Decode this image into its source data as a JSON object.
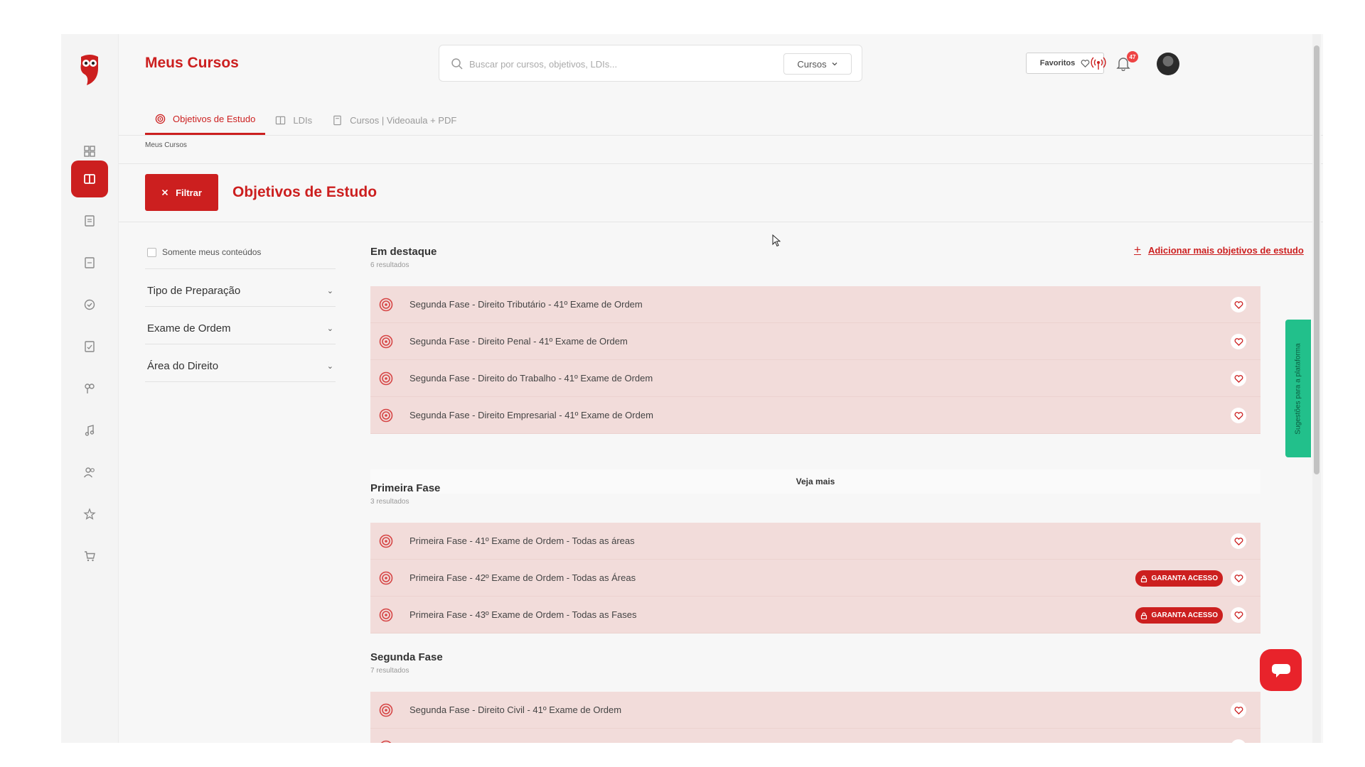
{
  "header": {
    "title": "Meus Cursos",
    "search_placeholder": "Buscar por cursos, objetivos, LDIs...",
    "search_scope": "Cursos",
    "favorites_label": "Favoritos",
    "notification_count": "47"
  },
  "tabs": [
    {
      "label": "Objetivos de Estudo",
      "icon": "target-icon",
      "active": true
    },
    {
      "label": "LDIs",
      "icon": "book-open-icon",
      "active": false
    },
    {
      "label": "Cursos | Videoaula + PDF",
      "icon": "book-icon",
      "active": false
    }
  ],
  "breadcrumb": "Meus Cursos",
  "filter_button": "Filtrar",
  "section_title": "Objetivos de Estudo",
  "filters": {
    "only_mine": "Somente meus conteúdos",
    "items": [
      "Tipo de Preparação",
      "Exame de Ordem",
      "Área do Direito"
    ]
  },
  "add_link": "Adicionar mais objetivos de estudo",
  "groups": [
    {
      "title": "Em destaque",
      "count": "6 resultados",
      "items": [
        {
          "label": "Segunda Fase - Direito Tributário - 41º Exame de Ordem",
          "badge": ""
        },
        {
          "label": "Segunda Fase - Direito Penal - 41º Exame de Ordem",
          "badge": ""
        },
        {
          "label": "Segunda Fase - Direito do Trabalho - 41º Exame de Ordem",
          "badge": ""
        },
        {
          "label": "Segunda Fase - Direito Empresarial - 41º Exame de Ordem",
          "badge": ""
        }
      ],
      "more_label": "Veja mais"
    },
    {
      "title": "Primeira Fase",
      "count": "3 resultados",
      "items": [
        {
          "label": "Primeira Fase - 41º Exame de Ordem - Todas as áreas",
          "badge": ""
        },
        {
          "label": "Primeira Fase - 42º Exame de Ordem - Todas as Áreas",
          "badge": "GARANTA ACESSO"
        },
        {
          "label": "Primeira Fase - 43º Exame de Ordem - Todas as Fases",
          "badge": "GARANTA ACESSO"
        }
      ]
    },
    {
      "title": "Segunda Fase",
      "count": "7 resultados",
      "items": [
        {
          "label": "Segunda Fase - Direito Civil - 41º Exame de Ordem",
          "badge": ""
        }
      ]
    }
  ],
  "suggestions_tab": "Sugestões para a plataforma",
  "colors": {
    "accent": "#cc1f1f",
    "row_bg": "#f2dcda",
    "suggest": "#22c08b"
  }
}
